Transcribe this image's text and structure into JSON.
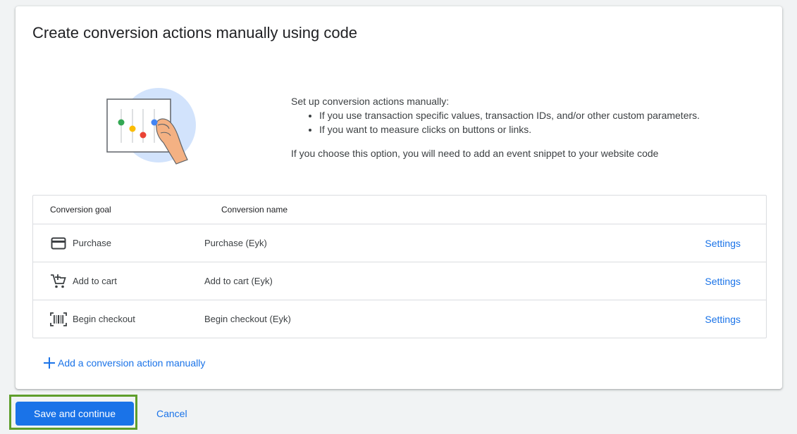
{
  "card": {
    "title": "Create conversion actions manually using code"
  },
  "info": {
    "intro": "Set up conversion actions manually:",
    "bullets": [
      "If you use transaction specific values, transaction IDs, and/or other custom parameters.",
      "If you want to measure clicks on buttons or links."
    ],
    "note": "If you choose this option, you will need to add an event snippet to your website code"
  },
  "table": {
    "headers": {
      "goal": "Conversion goal",
      "name": "Conversion name"
    },
    "rows": [
      {
        "goal": "Purchase",
        "name": "Purchase (Eyk)",
        "action": "Settings",
        "icon": "credit-card-icon"
      },
      {
        "goal": "Add to cart",
        "name": "Add to cart (Eyk)",
        "action": "Settings",
        "icon": "add-shopping-cart-icon"
      },
      {
        "goal": "Begin checkout",
        "name": "Begin checkout (Eyk)",
        "action": "Settings",
        "icon": "barcode-scanner-icon"
      }
    ]
  },
  "add_link": {
    "label": "Add a conversion action manually",
    "icon": "plus-icon"
  },
  "footer": {
    "save_label": "Save and continue",
    "cancel_label": "Cancel"
  },
  "colors": {
    "accent": "#1a73e8",
    "highlight": "#5f9e2b",
    "background": "#f1f3f4"
  }
}
